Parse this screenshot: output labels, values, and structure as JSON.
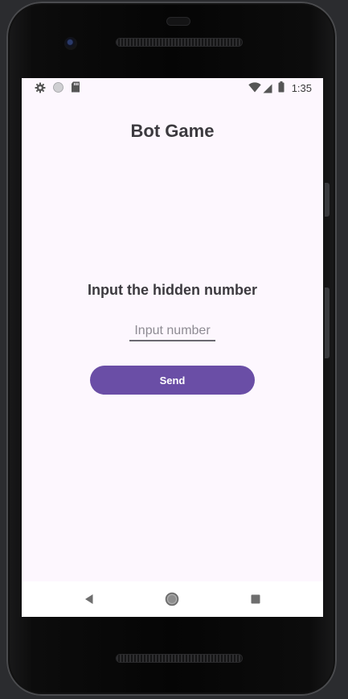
{
  "status_bar": {
    "time": "1:35",
    "left_icons": [
      "gear-icon",
      "circle-icon",
      "sd-card-icon"
    ],
    "right_icons": [
      "wifi-icon",
      "signal-icon",
      "battery-icon"
    ]
  },
  "app": {
    "title": "Bot Game",
    "prompt": "Input the hidden number",
    "input": {
      "value": "",
      "placeholder": "Input number"
    },
    "send_label": "Send"
  },
  "nav_bar": {
    "icons": [
      "back-icon",
      "home-icon",
      "recents-icon"
    ]
  },
  "colors": {
    "screen_background": "#fdf7fe",
    "accent": "#6a4ea6",
    "text": "#3c3a3f"
  }
}
